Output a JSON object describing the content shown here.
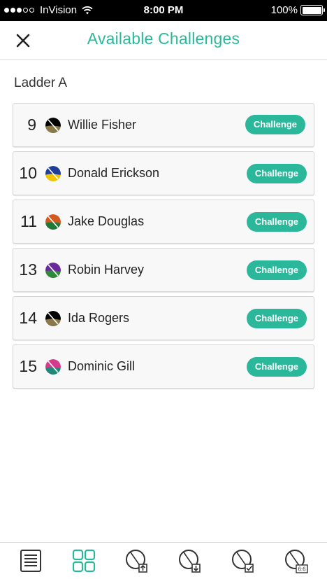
{
  "status_bar": {
    "carrier": "InVision",
    "time": "8:00 PM",
    "battery": "100%",
    "battery_level": 1.0
  },
  "header": {
    "title": "Available Challenges",
    "close_icon": "close-icon"
  },
  "section": {
    "title": "Ladder A"
  },
  "players": [
    {
      "rank": "9",
      "name": "Willie Fisher",
      "button": "Challenge",
      "colors": [
        "#000000",
        "#8a7a4a"
      ]
    },
    {
      "rank": "10",
      "name": "Donald Erickson",
      "button": "Challenge",
      "colors": [
        "#1f3d99",
        "#f2c500"
      ]
    },
    {
      "rank": "11",
      "name": "Jake Douglas",
      "button": "Challenge",
      "colors": [
        "#d35a1f",
        "#1f7a3a"
      ]
    },
    {
      "rank": "13",
      "name": "Robin Harvey",
      "button": "Challenge",
      "colors": [
        "#6a2a9c",
        "#2f8a3a"
      ]
    },
    {
      "rank": "14",
      "name": "Ida Rogers",
      "button": "Challenge",
      "colors": [
        "#000000",
        "#8a7a4a"
      ]
    },
    {
      "rank": "15",
      "name": "Dominic Gill",
      "button": "Challenge",
      "colors": [
        "#d63a8a",
        "#1d8a7a"
      ]
    }
  ],
  "tab_bar": {
    "tabs": [
      {
        "icon": "list-icon",
        "active": false
      },
      {
        "icon": "grid-icon",
        "active": true
      },
      {
        "icon": "challenge-up-icon",
        "active": false
      },
      {
        "icon": "challenge-down-icon",
        "active": false
      },
      {
        "icon": "challenge-check-icon",
        "active": false
      },
      {
        "icon": "score-icon",
        "label": "6:6",
        "active": false
      }
    ]
  },
  "colors": {
    "accent": "#2bb89a",
    "text": "#222222",
    "tab_inactive": "#333333"
  }
}
